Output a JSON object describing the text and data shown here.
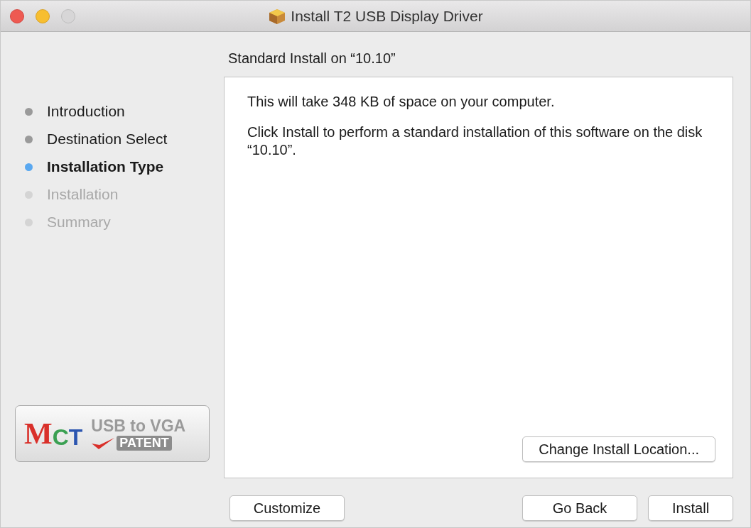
{
  "window": {
    "title": "Install T2 USB Display Driver"
  },
  "steps": [
    {
      "label": "Introduction",
      "selected": false,
      "disabled": false
    },
    {
      "label": "Destination Select",
      "selected": false,
      "disabled": false
    },
    {
      "label": "Installation Type",
      "selected": true,
      "disabled": false
    },
    {
      "label": "Installation",
      "selected": false,
      "disabled": true
    },
    {
      "label": "Summary",
      "selected": false,
      "disabled": true
    }
  ],
  "logo": {
    "letters": [
      {
        "text": "M",
        "color": "#d9302a"
      },
      {
        "text": "C",
        "color": "#3aa052"
      },
      {
        "text": "T",
        "color": "#2b55b0"
      }
    ],
    "line_1": "USB to VGA",
    "line_2": "PATENT"
  },
  "heading": "Standard Install on “10.10”",
  "paragraphs": [
    "This will take 348 KB of space on your computer.",
    "Click Install to perform a standard installation of this software on the disk “10.10”."
  ],
  "change_location_button": "Change Install Location...",
  "buttons": {
    "left": "Customize",
    "right": [
      "Go Back",
      "Install"
    ]
  }
}
